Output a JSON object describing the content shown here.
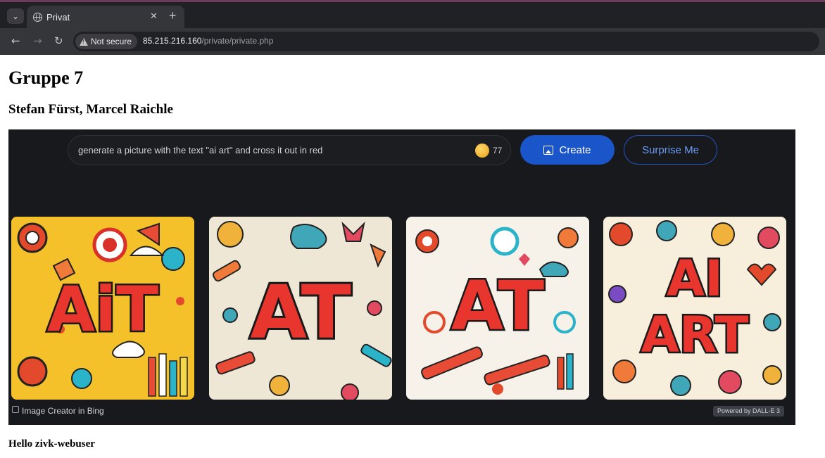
{
  "browser": {
    "tab_title": "Privat",
    "new_tab_symbol": "+",
    "security_label": "Not secure",
    "url_host": "85.215.216.160",
    "url_path": "/private/private.php"
  },
  "page": {
    "heading": "Gruppe 7",
    "authors": "Stefan Fürst, Marcel Raichle",
    "greeting": "Hello zivk-webuser"
  },
  "image_creator": {
    "prompt_text": "generate a picture with the text \"ai art\" and cross it out in red",
    "boost_count": "77",
    "create_label": "Create",
    "surprise_label": "Surprise Me",
    "footer_label": "Image Creator in Bing",
    "badge_label": "Powered by DALL-E 3",
    "images": [
      {
        "text_top": "AiT",
        "accent": "#e8352e"
      },
      {
        "text_top": "AT",
        "accent": "#e8352e"
      },
      {
        "text_top": "AT",
        "accent": "#e8352e"
      },
      {
        "text_top": "AI",
        "text_bottom": "ART",
        "accent": "#e8352e"
      }
    ]
  }
}
